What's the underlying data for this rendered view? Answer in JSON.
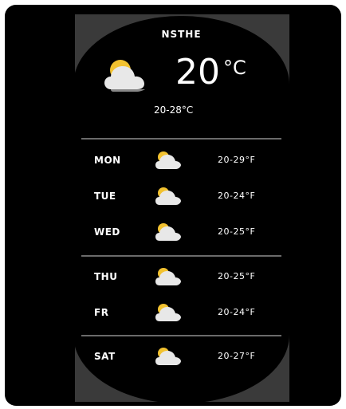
{
  "widget": {
    "title": "NSTHE",
    "current": {
      "icon": "partly-cloudy-icon",
      "temp": "20",
      "unit": "°C",
      "range": "20-28°C"
    },
    "forecast": [
      {
        "day": "MON",
        "icon": "partly-cloudy-icon",
        "range": "20-29°F"
      },
      {
        "day": "TUE",
        "icon": "partly-cloudy-icon",
        "range": "20-24°F"
      },
      {
        "day": "WED",
        "icon": "partly-cloudy-icon",
        "range": "20-25°F"
      },
      {
        "day": "THU",
        "icon": "partly-cloudy-icon",
        "range": "20-25°F"
      },
      {
        "day": "FR",
        "icon": "partly-cloudy-icon",
        "range": "20-24°F"
      },
      {
        "day": "SAT",
        "icon": "partly-cloudy-icon",
        "range": "20-27°F"
      }
    ]
  },
  "colors": {
    "background": "#000000",
    "panel": "#3a3a3a",
    "divider": "#6b6b6b",
    "sun": "#f2c230",
    "cloud": "#e8e8e8",
    "text": "#ffffff"
  }
}
